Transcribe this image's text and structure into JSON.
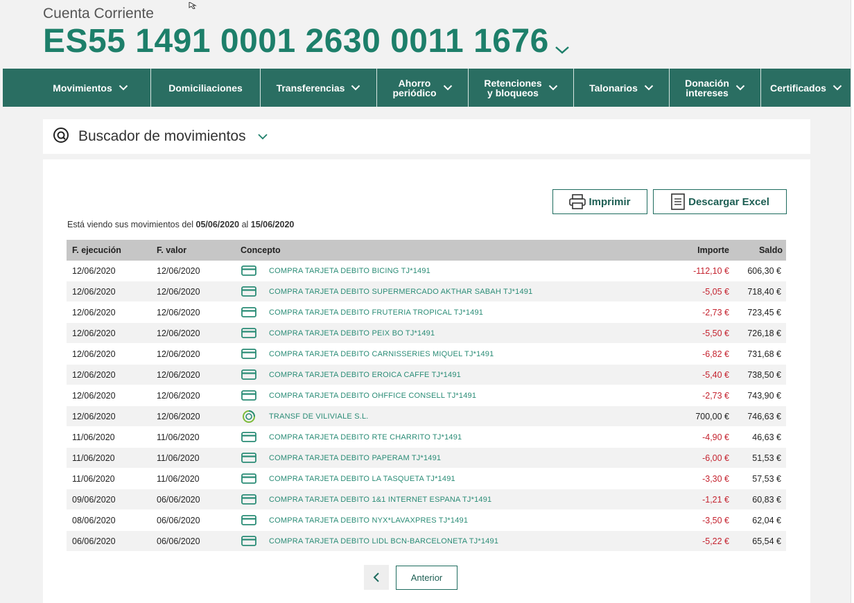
{
  "account": {
    "type_label": "Cuenta Corriente",
    "number": "ES55 1491 0001 2630 0011 1676"
  },
  "nav": [
    {
      "label": "Movimientos",
      "has_chevron": true
    },
    {
      "label": "Domiciliaciones",
      "has_chevron": false
    },
    {
      "label": "Transferencias",
      "has_chevron": true
    },
    {
      "label": "Ahorro\nperiódico",
      "has_chevron": true
    },
    {
      "label": "Retenciones\ny bloqueos",
      "has_chevron": true
    },
    {
      "label": "Talonarios",
      "has_chevron": true
    },
    {
      "label": "Donación\nintereses",
      "has_chevron": true
    },
    {
      "label": "Certificados",
      "has_chevron": true
    }
  ],
  "search": {
    "title": "Buscador de movimientos"
  },
  "actions": {
    "print_label": "Imprimir",
    "excel_label": "Descargar Excel"
  },
  "range": {
    "prefix": "Está viendo sus movimientos del",
    "from": "05/06/2020",
    "middle": "al",
    "to": "15/06/2020"
  },
  "table": {
    "headers": {
      "ejecucion": "F. ejecución",
      "valor": "F. valor",
      "concepto": "Concepto",
      "importe": "Importe",
      "saldo": "Saldo"
    },
    "rows": [
      {
        "ejecucion": "12/06/2020",
        "valor": "12/06/2020",
        "icon": "card-icon",
        "concepto": "COMPRA TARJETA DEBITO BICING TJ*1491",
        "importe": "-112,10 €",
        "negative": true,
        "saldo": "606,30 €"
      },
      {
        "ejecucion": "12/06/2020",
        "valor": "12/06/2020",
        "icon": "card-icon",
        "concepto": "COMPRA TARJETA DEBITO SUPERMERCADO AKTHAR SABAH TJ*1491",
        "importe": "-5,05 €",
        "negative": true,
        "saldo": "718,40 €"
      },
      {
        "ejecucion": "12/06/2020",
        "valor": "12/06/2020",
        "icon": "card-icon",
        "concepto": "COMPRA TARJETA DEBITO FRUTERIA TROPICAL TJ*1491",
        "importe": "-2,73 €",
        "negative": true,
        "saldo": "723,45 €"
      },
      {
        "ejecucion": "12/06/2020",
        "valor": "12/06/2020",
        "icon": "card-icon",
        "concepto": "COMPRA TARJETA DEBITO PEIX BO TJ*1491",
        "importe": "-5,50 €",
        "negative": true,
        "saldo": "726,18 €"
      },
      {
        "ejecucion": "12/06/2020",
        "valor": "12/06/2020",
        "icon": "card-icon",
        "concepto": "COMPRA TARJETA DEBITO CARNISSERIES MIQUEL TJ*1491",
        "importe": "-6,82 €",
        "negative": true,
        "saldo": "731,68 €"
      },
      {
        "ejecucion": "12/06/2020",
        "valor": "12/06/2020",
        "icon": "card-icon",
        "concepto": "COMPRA TARJETA DEBITO EROICA CAFFE TJ*1491",
        "importe": "-5,40 €",
        "negative": true,
        "saldo": "738,50 €"
      },
      {
        "ejecucion": "12/06/2020",
        "valor": "12/06/2020",
        "icon": "card-icon",
        "concepto": "COMPRA TARJETA DEBITO OHFFICE CONSELL TJ*1491",
        "importe": "-2,73 €",
        "negative": true,
        "saldo": "743,90 €"
      },
      {
        "ejecucion": "12/06/2020",
        "valor": "12/06/2020",
        "icon": "transfer-icon",
        "concepto": "TRANSF DE VILIVIALE S.L.",
        "importe": "700,00 €",
        "negative": false,
        "saldo": "746,63 €"
      },
      {
        "ejecucion": "11/06/2020",
        "valor": "11/06/2020",
        "icon": "card-icon",
        "concepto": "COMPRA TARJETA DEBITO RTE CHARRITO TJ*1491",
        "importe": "-4,90 €",
        "negative": true,
        "saldo": "46,63 €"
      },
      {
        "ejecucion": "11/06/2020",
        "valor": "11/06/2020",
        "icon": "card-icon",
        "concepto": "COMPRA TARJETA DEBITO PAPERAM TJ*1491",
        "importe": "-6,00 €",
        "negative": true,
        "saldo": "51,53 €"
      },
      {
        "ejecucion": "11/06/2020",
        "valor": "11/06/2020",
        "icon": "card-icon",
        "concepto": "COMPRA TARJETA DEBITO LA TASQUETA TJ*1491",
        "importe": "-3,30 €",
        "negative": true,
        "saldo": "57,53 €"
      },
      {
        "ejecucion": "09/06/2020",
        "valor": "06/06/2020",
        "icon": "card-icon",
        "concepto": "COMPRA TARJETA DEBITO 1&1 INTERNET ESPANA TJ*1491",
        "importe": "-1,21 €",
        "negative": true,
        "saldo": "60,83 €"
      },
      {
        "ejecucion": "08/06/2020",
        "valor": "06/06/2020",
        "icon": "card-icon",
        "concepto": "COMPRA TARJETA DEBITO NYX*LAVAXPRES TJ*1491",
        "importe": "-3,50 €",
        "negative": true,
        "saldo": "62,04 €"
      },
      {
        "ejecucion": "06/06/2020",
        "valor": "06/06/2020",
        "icon": "card-icon",
        "concepto": "COMPRA TARJETA DEBITO LIDL BCN-BARCELONETA TJ*1491",
        "importe": "-5,22 €",
        "negative": true,
        "saldo": "65,54 €"
      }
    ]
  },
  "pagination": {
    "prev_label": "Anterior"
  },
  "colors": {
    "brand_green": "#1d7f6a",
    "nav_bg": "#2a6e62",
    "negative_amount": "#c4222e",
    "concept_link": "#2a8c76"
  }
}
